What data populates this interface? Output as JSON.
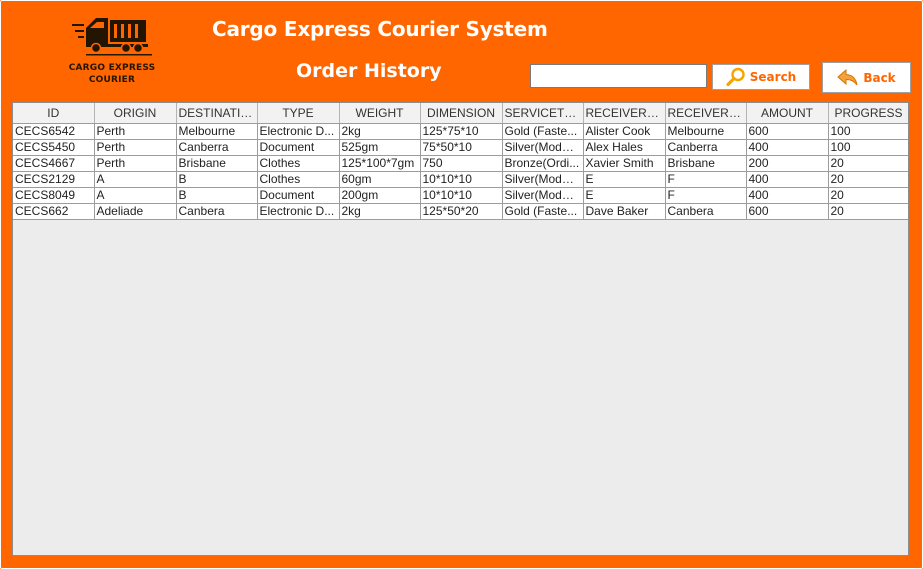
{
  "colors": {
    "background": "#ff6600",
    "accent": "#ff6600",
    "title_text": "#ffffff"
  },
  "logo": {
    "line1": "CARGO EXPRESS",
    "line2": "COURIER",
    "icon": "truck-icon"
  },
  "header": {
    "app_title": "Cargo Express Courier System",
    "page_title": "Order History"
  },
  "search": {
    "value": "",
    "placeholder": "",
    "button_label": "Search",
    "icon": "search-icon"
  },
  "back": {
    "label": "Back",
    "icon": "back-arrow-icon"
  },
  "table": {
    "columns": [
      "ID",
      "ORIGIN",
      "DESTINATION",
      "TYPE",
      "WEIGHT",
      "DIMENSION",
      "SERVICETY...",
      "RECEIVERN...",
      "RECEIVERA...",
      "AMOUNT",
      "PROGRESS"
    ],
    "rows": [
      [
        "CECS6542",
        "Perth",
        "Melbourne",
        "Electronic D...",
        "2kg",
        "125*75*10",
        "Gold (Faste...",
        "Alister Cook",
        "Melbourne",
        "600",
        "100"
      ],
      [
        "CECS5450",
        "Perth",
        "Canberra",
        "Document",
        "525gm",
        "75*50*10",
        "Silver(Moder...",
        "Alex Hales",
        "Canberra",
        "400",
        "100"
      ],
      [
        "CECS4667",
        "Perth",
        "Brisbane",
        "Clothes",
        "125*100*7gm",
        "750",
        "Bronze(Ordi...",
        "Xavier Smith",
        "Brisbane",
        "200",
        "20"
      ],
      [
        "CECS2129",
        "A",
        "B",
        "Clothes",
        "60gm",
        "10*10*10",
        "Silver(Moder...",
        "E",
        "F",
        "400",
        "20"
      ],
      [
        "CECS8049",
        "A",
        "B",
        "Document",
        "200gm",
        "10*10*10",
        "Silver(Moder...",
        "E",
        "F",
        "400",
        "20"
      ],
      [
        "CECS662",
        "Adeliade",
        "Canbera",
        "Electronic D...",
        "2kg",
        "125*50*20",
        "Gold (Faste...",
        "Dave Baker",
        "Canbera",
        "600",
        "20"
      ]
    ]
  }
}
